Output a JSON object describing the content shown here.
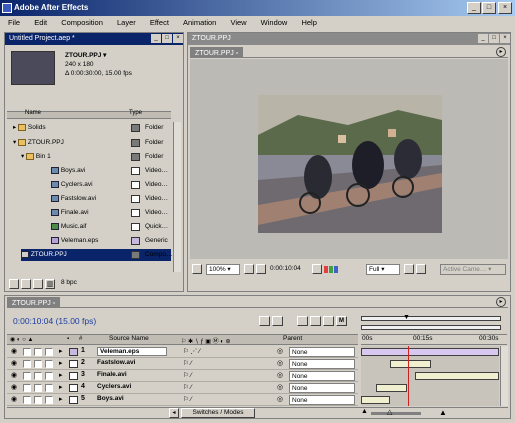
{
  "window": {
    "title": "Adobe After Effects",
    "controls": [
      "_",
      "□",
      "×"
    ]
  },
  "menu": [
    "File",
    "Edit",
    "Composition",
    "Layer",
    "Effect",
    "Animation",
    "View",
    "Window",
    "Help"
  ],
  "project": {
    "title": "Untitled Project.aep *",
    "selected_item": "ZTOUR.PPJ ▾",
    "size": "240 x 180",
    "duration": "Δ 0:00:30:00, 15.00 fps",
    "col_name": "Name",
    "col_type": "Type",
    "items": [
      {
        "name": "Solids",
        "type": "Folder",
        "kind": "folder",
        "color": "#7a7a7a"
      },
      {
        "name": "ZTOUR.PPJ",
        "type": "Folder",
        "kind": "folder",
        "color": "#7a7a7a"
      },
      {
        "name": "Bin 1",
        "type": "Folder",
        "kind": "folder",
        "color": "#7a7a7a"
      },
      {
        "name": "Boys.avi",
        "type": "Video…",
        "kind": "film",
        "color": "#ffffff"
      },
      {
        "name": "Cyclers.avi",
        "type": "Video…",
        "kind": "film",
        "color": "#ffffff"
      },
      {
        "name": "Fastslow.avi",
        "type": "Video…",
        "kind": "film",
        "color": "#ffffff"
      },
      {
        "name": "Finale.avi",
        "type": "Video…",
        "kind": "film",
        "color": "#ffffff"
      },
      {
        "name": "Music.aif",
        "type": "Quick…",
        "kind": "audio",
        "color": "#ffffff"
      },
      {
        "name": "Veleman.eps",
        "type": "Generic",
        "kind": "eps",
        "color": "#c8b8e0"
      },
      {
        "name": "ZTOUR.PPJ",
        "type": "Compo…",
        "kind": "comp",
        "color": "#7a7a7a"
      }
    ],
    "footer_label": "8 bpc"
  },
  "comp": {
    "title": "ZTOUR.PPJ",
    "tab": "ZTOUR.PPJ",
    "zoom": "100%",
    "timecode": "0:00:10:04",
    "resolution": "Full",
    "camera": "Active Came…"
  },
  "timeline": {
    "tab": "ZTOUR.PPJ",
    "timecode": "0:00:10:04",
    "fps": "(15.00 fps)",
    "col_source": "Source Name",
    "col_parent": "Parent",
    "ruler": [
      "00s",
      "00:15s",
      "00:30s"
    ],
    "layers": [
      {
        "num": "1",
        "name": "Veleman.eps",
        "parent": "None",
        "color": "#c8b8e0"
      },
      {
        "num": "2",
        "name": "Fastslow.avi",
        "parent": "None",
        "color": "#ffffff"
      },
      {
        "num": "3",
        "name": "Finale.avi",
        "parent": "None",
        "color": "#ffffff"
      },
      {
        "num": "4",
        "name": "Cyclers.avi",
        "parent": "None",
        "color": "#ffffff"
      },
      {
        "num": "5",
        "name": "Boys.avi",
        "parent": "None",
        "color": "#ffffff"
      }
    ],
    "switches_label": "Switches / Modes",
    "layer_bars": [
      {
        "start": 0.0,
        "end": 1.0,
        "color": "#d8c8f0"
      },
      {
        "start": 0.21,
        "end": 0.51,
        "color": "#f0f0d0"
      },
      {
        "start": 0.39,
        "end": 1.0,
        "color": "#f0f0d0"
      },
      {
        "start": 0.11,
        "end": 0.33,
        "color": "#f0f0d0"
      },
      {
        "start": 0.0,
        "end": 0.21,
        "color": "#f0f0d0"
      }
    ],
    "playhead": 0.34
  },
  "colors": {
    "title_active": "#0a246a",
    "timecode": "#1a3ca0",
    "chrome": "#d4d0c8"
  }
}
